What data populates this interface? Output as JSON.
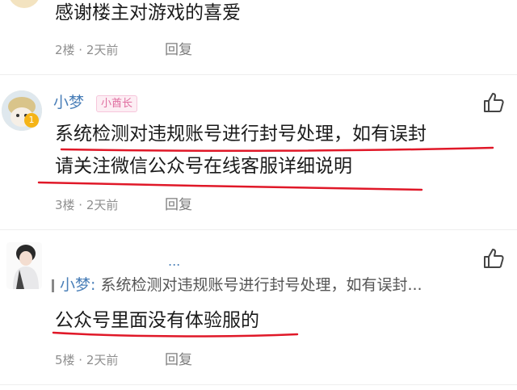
{
  "comment1": {
    "text": "感谢楼主对游戏的喜爱",
    "floor_time": "2楼 · 2天前",
    "reply_label": "回复"
  },
  "comment2": {
    "username": "小梦",
    "badge": "小酋长",
    "line1": "系统检测对违规账号进行封号处理，如有误封",
    "line2": "请关注微信公众号在线客服详细说明",
    "floor_time": "3楼 · 2天前",
    "reply_label": "回复",
    "avatar_badge": "1"
  },
  "comment3": {
    "username": "...",
    "quote_user": "小梦:",
    "quote_text": " 系统检测对违规账号进行封号处理，如有误封...",
    "text": "公众号里面没有体验服的",
    "floor_time": "5楼 · 2天前",
    "reply_label": "回复"
  },
  "colors": {
    "underline_red": "#e01828",
    "username_blue": "#4a7fb8",
    "meta_gray": "#8f8f8f",
    "divider": "#eeeeee"
  }
}
